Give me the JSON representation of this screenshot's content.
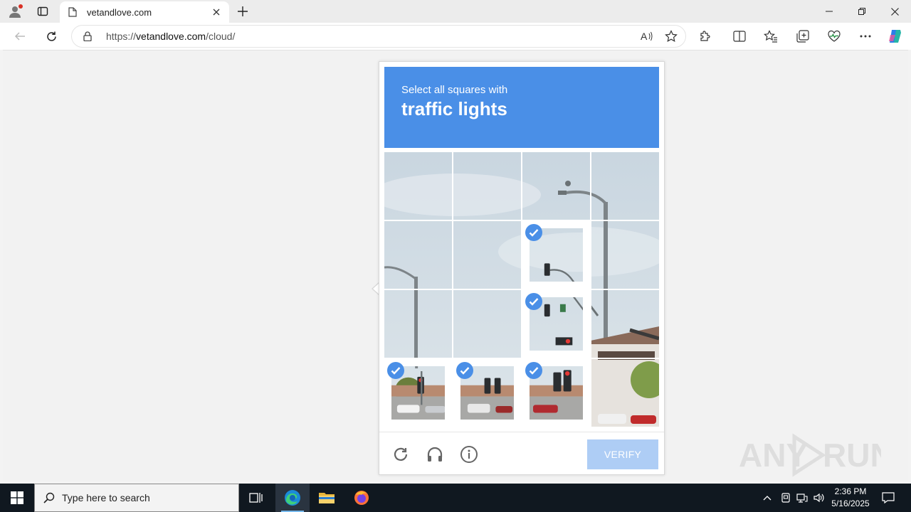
{
  "browser": {
    "tab_title": "vetandlove.com",
    "url_prefix": "https://",
    "url_host": "vetandlove.com",
    "url_path": "/cloud/"
  },
  "captcha": {
    "instruction_small": "Select all squares with",
    "instruction_big": "traffic lights",
    "verify_label": "VERIFY",
    "selected_tiles": [
      6,
      10,
      12,
      13,
      14
    ],
    "accent_color": "#4a8fe7"
  },
  "watermark": {
    "text": "ANY RUN"
  },
  "taskbar": {
    "search_placeholder": "Type here to search",
    "time": "2:36 PM",
    "date": "5/16/2025"
  }
}
